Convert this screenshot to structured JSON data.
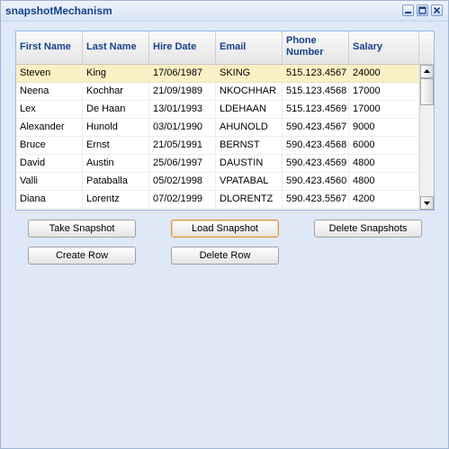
{
  "window": {
    "title": "snapshotMechanism"
  },
  "grid": {
    "columns": [
      "First Name",
      "Last Name",
      "Hire Date",
      "Email",
      "Phone\nNumber",
      "Salary"
    ],
    "selected_row": 0,
    "rows": [
      [
        "Steven",
        "King",
        "17/06/1987",
        "SKING",
        "515.123.4567",
        "24000"
      ],
      [
        "Neena",
        "Kochhar",
        "21/09/1989",
        "NKOCHHAR",
        "515.123.4568",
        "17000"
      ],
      [
        "Lex",
        "De Haan",
        "13/01/1993",
        "LDEHAAN",
        "515.123.4569",
        "17000"
      ],
      [
        "Alexander",
        "Hunold",
        "03/01/1990",
        "AHUNOLD",
        "590.423.4567",
        "9000"
      ],
      [
        "Bruce",
        "Ernst",
        "21/05/1991",
        "BERNST",
        "590.423.4568",
        "6000"
      ],
      [
        "David",
        "Austin",
        "25/06/1997",
        "DAUSTIN",
        "590.423.4569",
        "4800"
      ],
      [
        "Valli",
        "Pataballa",
        "05/02/1998",
        "VPATABAL",
        "590.423.4560",
        "4800"
      ],
      [
        "Diana",
        "Lorentz",
        "07/02/1999",
        "DLORENTZ",
        "590.423.5567",
        "4200"
      ]
    ]
  },
  "buttons": {
    "take_snapshot": "Take Snapshot",
    "load_snapshot": "Load Snapshot",
    "delete_snapshots": "Delete Snapshots",
    "create_row": "Create Row",
    "delete_row": "Delete Row"
  },
  "colors": {
    "window_bg": "#dfe8f6",
    "title_text": "#15428b",
    "selected_row": "#fbf0c3"
  }
}
